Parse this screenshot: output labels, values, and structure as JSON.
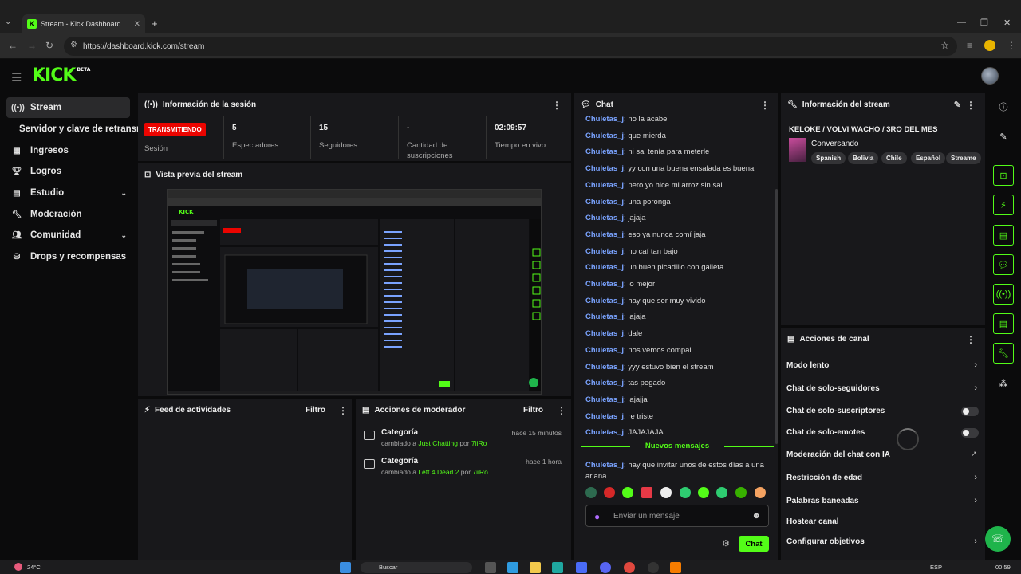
{
  "browser": {
    "tab_title": "Stream - Kick Dashboard",
    "url": "https://dashboard.kick.com/stream"
  },
  "app": {
    "logo": "KICK",
    "logo_badge": "BETA"
  },
  "sidebar": {
    "items": [
      {
        "label": "Stream",
        "icon": "broadcast-icon"
      },
      {
        "label": "Servidor y clave de retransm",
        "icon": ""
      },
      {
        "label": "Ingresos",
        "icon": "chart-icon"
      },
      {
        "label": "Logros",
        "icon": "trophy-icon"
      },
      {
        "label": "Estudio",
        "icon": "studio-icon"
      },
      {
        "label": "Moderación",
        "icon": "wrench-icon"
      },
      {
        "label": "Comunidad",
        "icon": "users-icon"
      },
      {
        "label": "Drops y recompensas",
        "icon": "drops-icon"
      }
    ]
  },
  "session": {
    "title": "Información de la sesión",
    "badge": "TRANSMITIENDO",
    "badge_label": "Sesión",
    "stats": [
      {
        "value": "5",
        "label": "Espectadores"
      },
      {
        "value": "15",
        "label": "Seguidores"
      },
      {
        "value": "-",
        "label": "Cantidad de suscripciones"
      },
      {
        "value": "02:09:57",
        "label": "Tiempo en vivo"
      }
    ],
    "colors": {
      "badge": "#eb0400"
    }
  },
  "preview": {
    "title": "Vista previa del stream"
  },
  "feed": {
    "title": "Feed de actividades",
    "filter": "Filtro"
  },
  "moderator": {
    "title": "Acciones de moderador",
    "filter": "Filtro",
    "entries": [
      {
        "title": "Categoría",
        "prefix": "cambiado a",
        "category": "Just Chatting",
        "by": "por",
        "user": "7iiRo",
        "time": "hace 15 minutos"
      },
      {
        "title": "Categoría",
        "prefix": "cambiado a",
        "category": "Left 4 Dead 2",
        "by": "por",
        "user": "7iiRo",
        "time": "hace 1 hora"
      }
    ]
  },
  "chat": {
    "title": "Chat",
    "messages": [
      {
        "user": "Chuletas_j",
        "text": ": no la acabe"
      },
      {
        "user": "Chuletas_j",
        "text": ": que mierda"
      },
      {
        "user": "Chuletas_j",
        "text": ": ni sal tenía para meterle"
      },
      {
        "user": "Chuletas_j",
        "text": ": yy con una buena ensalada es buena"
      },
      {
        "user": "Chuletas_j",
        "text": ": pero yo hice mi arroz sin sal"
      },
      {
        "user": "Chuletas_j",
        "text": ": una poronga"
      },
      {
        "user": "Chuletas_j",
        "text": ": jajaja"
      },
      {
        "user": "Chuletas_j",
        "text": ": eso ya nunca comí jaja"
      },
      {
        "user": "Chuletas_j",
        "text": ": no caí tan bajo"
      },
      {
        "user": "Chuletas_j",
        "text": ": un buen picadillo con galleta"
      },
      {
        "user": "Chuletas_j",
        "text": ": lo mejor"
      },
      {
        "user": "Chuletas_j",
        "text": ": hay que ser muy vivido"
      },
      {
        "user": "Chuletas_j",
        "text": ": jajaja"
      },
      {
        "user": "Chuletas_j",
        "text": ": dale"
      },
      {
        "user": "Chuletas_j",
        "text": ": nos vemos compai"
      },
      {
        "user": "Chuletas_j",
        "text": ": yyy estuvo bien el stream"
      },
      {
        "user": "Chuletas_j",
        "text": ": tas pegado"
      },
      {
        "user": "Chuletas_j",
        "text": ": jajajja"
      },
      {
        "user": "Chuletas_j",
        "text": ": re triste"
      },
      {
        "user": "Chuletas_j",
        "text": ": JAJAJAJA"
      }
    ],
    "new_messages": "Nuevos mensajes",
    "new_message": {
      "user": "Chuletas_j",
      "text": ": hay que invitar unos de estos días a una",
      "text2": "ariana"
    },
    "input_placeholder": "Enviar un mensaje",
    "send_label": "Chat",
    "colors": {
      "username": "#7aa3ff",
      "accent": "#53fc18"
    }
  },
  "stream_info": {
    "title": "Información del stream",
    "stream_title": "KELOKE / VOLVI WACHO / 3RO DEL MES",
    "category": "Conversando",
    "tags": [
      "Spanish",
      "Bolivia",
      "Chile",
      "Español",
      "Streame"
    ]
  },
  "channel_actions": {
    "title": "Acciones de canal",
    "items": [
      {
        "label": "Modo lento",
        "control": "chevron"
      },
      {
        "label": "Chat de solo-seguidores",
        "control": "chevron"
      },
      {
        "label": "Chat de solo-suscriptores",
        "control": "toggle-off"
      },
      {
        "label": "Chat de solo-emotes",
        "control": "toggle-off"
      },
      {
        "label": "Moderación del chat con IA",
        "control": "external"
      },
      {
        "label": "Restricción de edad",
        "control": "chevron"
      },
      {
        "label": "Palabras baneadas",
        "control": "chevron"
      },
      {
        "label": "Hostear canal",
        "control": "none"
      },
      {
        "label": "Configurar objetivos",
        "control": "chevron"
      }
    ]
  },
  "taskbar": {
    "weather": "24°C",
    "search": "Buscar",
    "lang": "ESP",
    "time": "00:59"
  }
}
